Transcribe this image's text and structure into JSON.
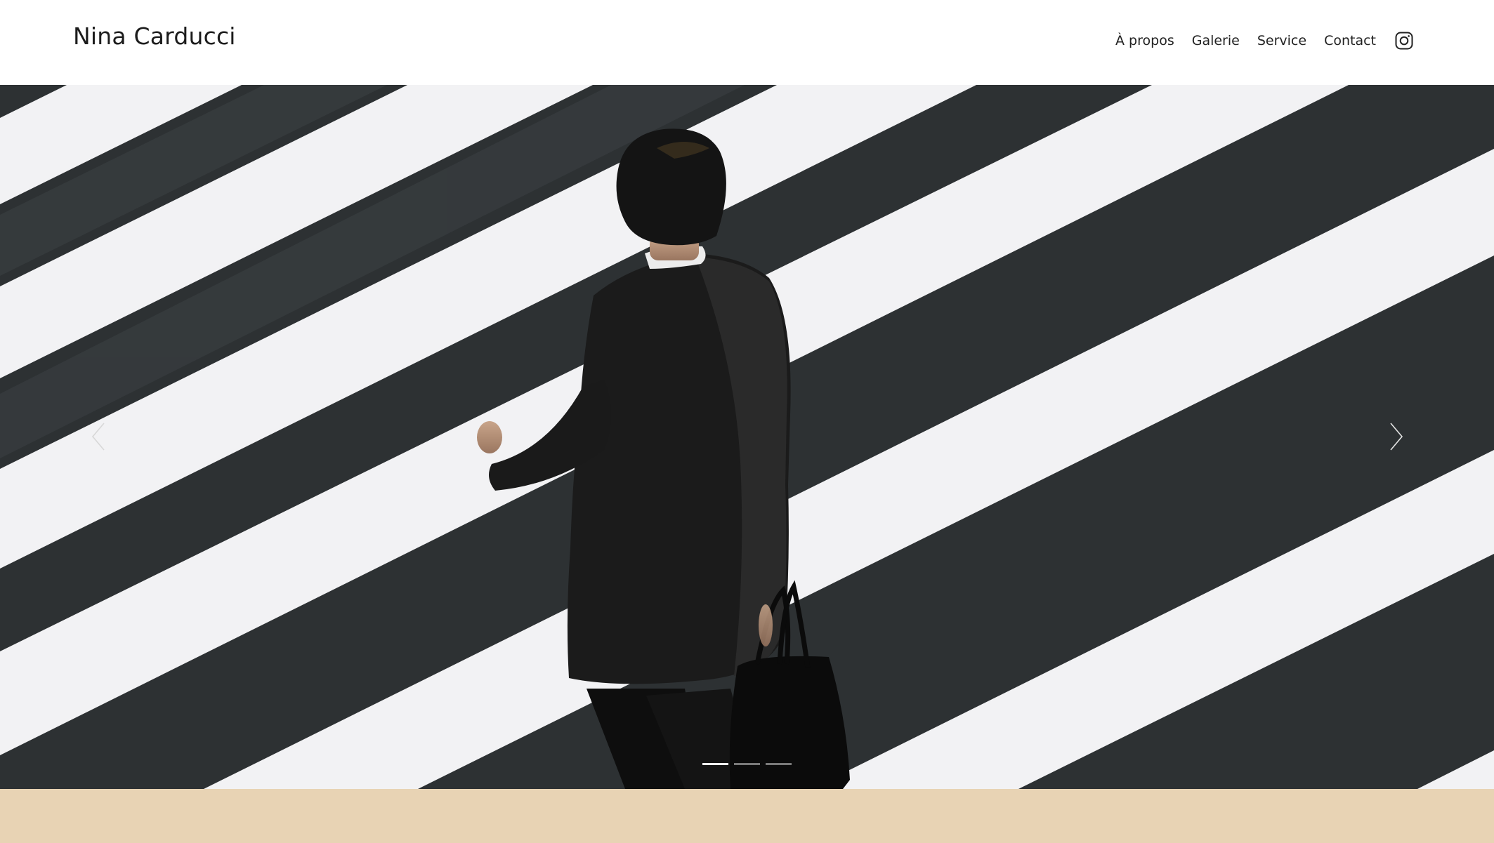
{
  "site": {
    "title": "Nina Carducci"
  },
  "nav": {
    "items": [
      {
        "label": "À propos"
      },
      {
        "label": "Galerie"
      },
      {
        "label": "Service"
      },
      {
        "label": "Contact"
      }
    ],
    "social_icon": "instagram-icon"
  },
  "carousel": {
    "photo_description_icon": "photo-slide",
    "prev_icon": "chevron-left-icon",
    "next_icon": "chevron-right-icon",
    "slide_count": 3,
    "active_slide": 1
  },
  "colors": {
    "header_bg": "#ffffff",
    "text": "#1c1c1c",
    "footer_band": "#e8d3b4",
    "asphalt": "#2d3133",
    "stripe": "#f3f3f5"
  }
}
